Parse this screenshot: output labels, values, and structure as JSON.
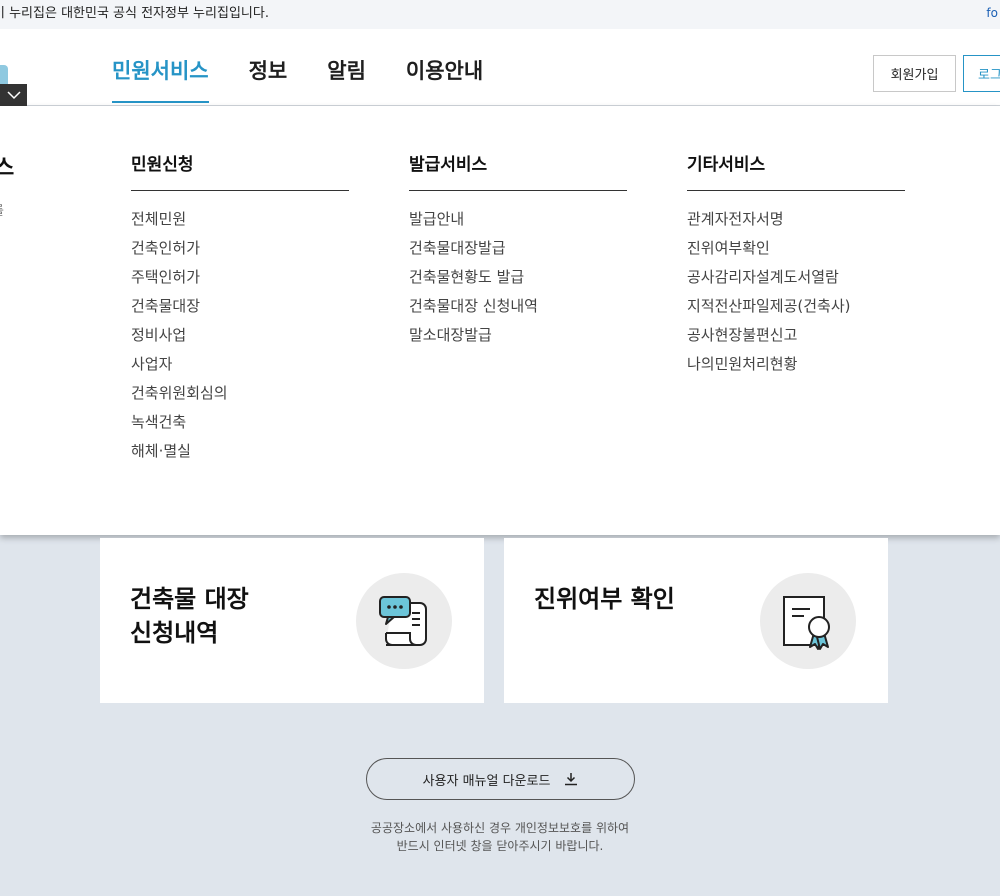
{
  "topbar": {
    "notice": "이 누리집은 대한민국 공식 전자정부 누리집입니다.",
    "right": "fo"
  },
  "gnb": {
    "items": [
      {
        "label": "민원서비스",
        "active": true
      },
      {
        "label": "정보",
        "active": false
      },
      {
        "label": "알림",
        "active": false
      },
      {
        "label": "이용안내",
        "active": false
      }
    ],
    "join_label": "회원가입",
    "login_label": "로그"
  },
  "mega": {
    "side_title": "스",
    "side_desc": "를",
    "columns": [
      {
        "title": "민원신청",
        "items": [
          "전체민원",
          "건축인허가",
          "주택인허가",
          "건축물대장",
          "정비사업",
          "사업자",
          "건축위원회심의",
          "녹색건축",
          "해체·멸실"
        ]
      },
      {
        "title": "발급서비스",
        "items": [
          "발급안내",
          "건축물대장발급",
          "건축물현황도 발급",
          "건축물대장 신청내역",
          "말소대장발급"
        ]
      },
      {
        "title": "기타서비스",
        "items": [
          "관계자전자서명",
          "진위여부확인",
          "공사감리자설계도서열람",
          "지적전산파일제공(건축사)",
          "공사현장불편신고",
          "나의민원처리현황"
        ]
      }
    ]
  },
  "cards": [
    {
      "line1": "건축물 대장",
      "line2": "신청내역",
      "icon": "document-chat-icon"
    },
    {
      "line1": "진위여부 확인",
      "line2": "",
      "icon": "certificate-icon"
    }
  ],
  "manual_label": "사용자 매뉴얼 다운로드",
  "footer": {
    "line1": "공공장소에서 사용하신 경우 개인정보보호를 위하여",
    "line2": "반드시 인터넷 창을 닫아주시기 바랍니다."
  },
  "colors": {
    "accent": "#2694c6",
    "background": "#dfe5ec"
  }
}
